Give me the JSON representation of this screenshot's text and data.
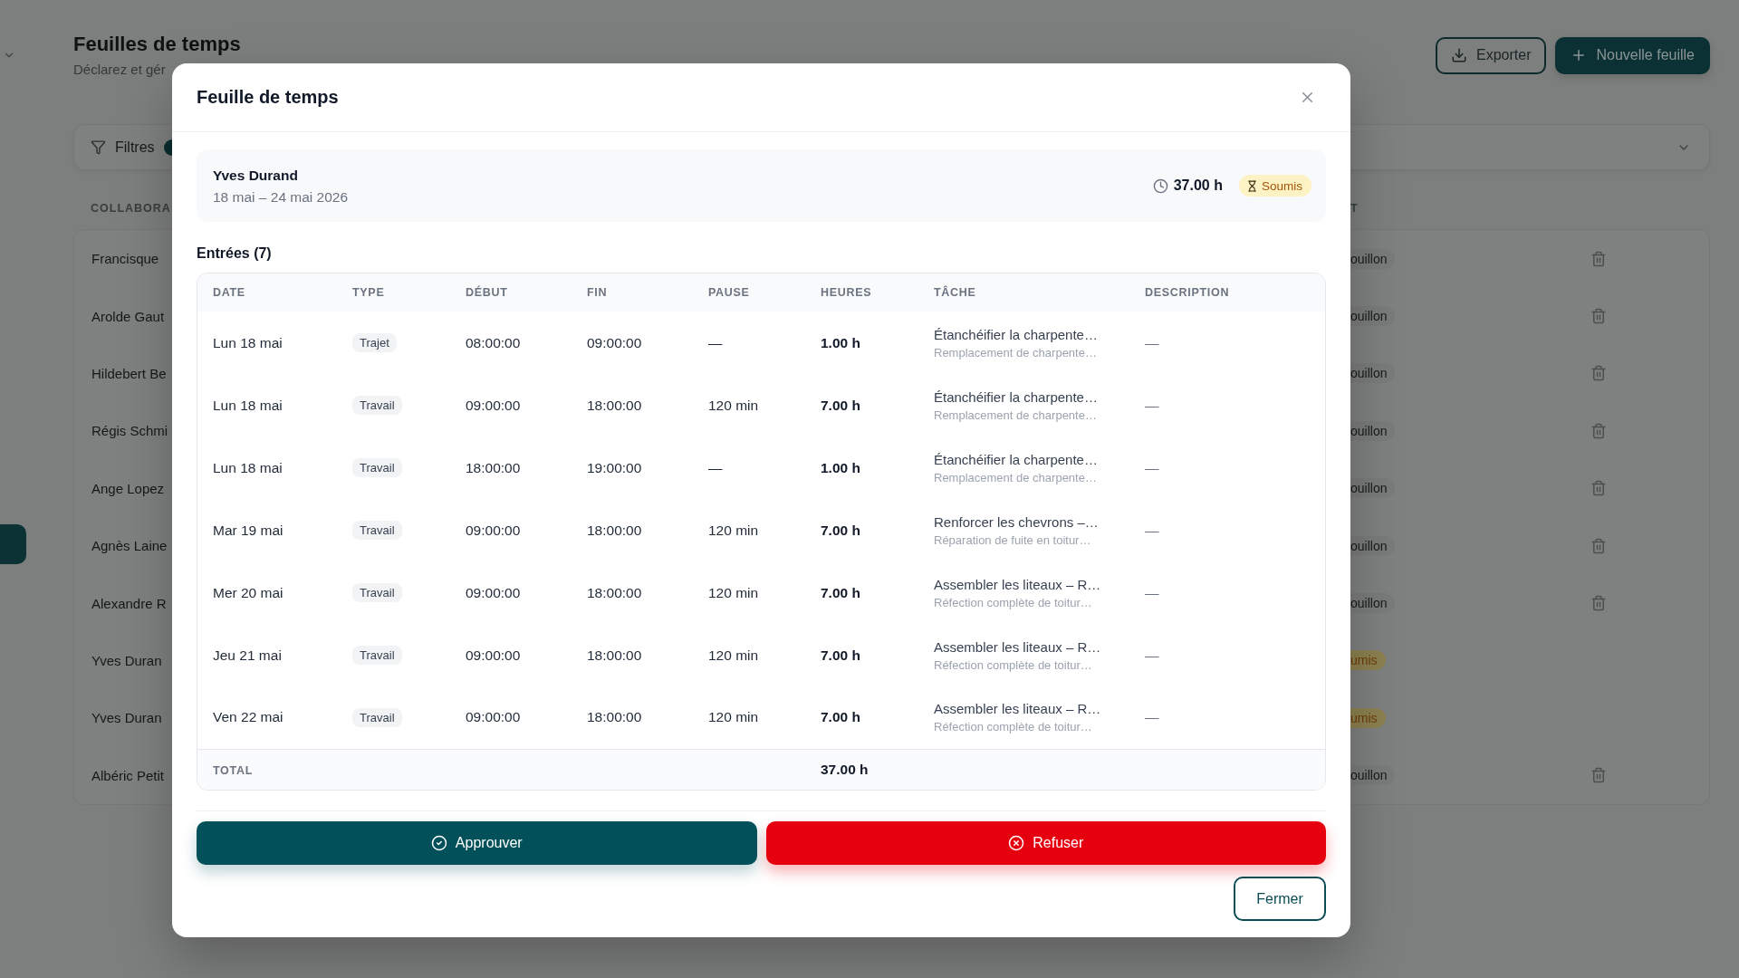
{
  "sidebar": {
    "items": [
      {
        "selected": true
      }
    ]
  },
  "page": {
    "title": "Feuilles de temps",
    "subtitle": "Déclarez et gér",
    "actions": [
      {
        "kind": "outline",
        "label": "Exporter"
      },
      {
        "kind": "primary",
        "label": "Nouvelle feuille"
      }
    ]
  },
  "filters": {
    "label": "Filtres"
  },
  "list": {
    "columns": [
      "COLLABORA",
      "T"
    ],
    "rows": [
      {
        "name": "Francisque",
        "status": {
          "label": "ouillon",
          "kind": "draft"
        }
      },
      {
        "name": "Arolde Gaut",
        "status": {
          "label": "ouillon",
          "kind": "draft"
        }
      },
      {
        "name": "Hildebert Be",
        "status": {
          "label": "ouillon",
          "kind": "draft"
        }
      },
      {
        "name": "Régis Schmi",
        "status": {
          "label": "ouillon",
          "kind": "draft"
        }
      },
      {
        "name": "Ange Lopez",
        "status": {
          "label": "ouillon",
          "kind": "draft"
        }
      },
      {
        "name": "Agnès Laine",
        "status": {
          "label": "ouillon",
          "kind": "draft"
        }
      },
      {
        "name": "Alexandre R",
        "status": {
          "label": "ouillon",
          "kind": "draft"
        }
      },
      {
        "name": "Yves Duran",
        "status": {
          "label": "umis",
          "kind": "submitted"
        }
      },
      {
        "name": "Yves Duran",
        "status": {
          "label": "umis",
          "kind": "submitted"
        }
      },
      {
        "name": "Albéric Petit",
        "status": {
          "label": "ouillon",
          "kind": "draft"
        }
      }
    ]
  },
  "modal": {
    "title": "Feuille de temps",
    "employee": "Yves Durand",
    "period": "18 mai – 24 mai 2026",
    "total_hours": "37.00 h",
    "status": {
      "label": "Soumis",
      "kind": "submitted"
    },
    "entries_title": "Entrées (7)",
    "table": {
      "columns": [
        "DATE",
        "TYPE",
        "DÉBUT",
        "FIN",
        "PAUSE",
        "HEURES",
        "TÂCHE",
        "DESCRIPTION"
      ],
      "rows": [
        {
          "date": "Lun 18 mai",
          "type": "Trajet",
          "start": "08:00:00",
          "end": "09:00:00",
          "pause": "—",
          "hours": "1.00 h",
          "task": "Étanchéifier la charpente…",
          "project": "Remplacement de charpente…",
          "description": "—"
        },
        {
          "date": "Lun 18 mai",
          "type": "Travail",
          "start": "09:00:00",
          "end": "18:00:00",
          "pause": "120 min",
          "hours": "7.00 h",
          "task": "Étanchéifier la charpente…",
          "project": "Remplacement de charpente…",
          "description": "—"
        },
        {
          "date": "Lun 18 mai",
          "type": "Travail",
          "start": "18:00:00",
          "end": "19:00:00",
          "pause": "—",
          "hours": "1.00 h",
          "task": "Étanchéifier la charpente…",
          "project": "Remplacement de charpente…",
          "description": "—"
        },
        {
          "date": "Mar 19 mai",
          "type": "Travail",
          "start": "09:00:00",
          "end": "18:00:00",
          "pause": "120 min",
          "hours": "7.00 h",
          "task": "Renforcer les chevrons –…",
          "project": "Réparation de fuite en toitur…",
          "description": "—"
        },
        {
          "date": "Mer 20 mai",
          "type": "Travail",
          "start": "09:00:00",
          "end": "18:00:00",
          "pause": "120 min",
          "hours": "7.00 h",
          "task": "Assembler les liteaux – R…",
          "project": "Réfection complète de toitur…",
          "description": "—"
        },
        {
          "date": "Jeu 21 mai",
          "type": "Travail",
          "start": "09:00:00",
          "end": "18:00:00",
          "pause": "120 min",
          "hours": "7.00 h",
          "task": "Assembler les liteaux – R…",
          "project": "Réfection complète de toitur…",
          "description": "—"
        },
        {
          "date": "Ven 22 mai",
          "type": "Travail",
          "start": "09:00:00",
          "end": "18:00:00",
          "pause": "120 min",
          "hours": "7.00 h",
          "task": "Assembler les liteaux – R…",
          "project": "Réfection complète de toitur…",
          "description": "—"
        }
      ],
      "total": {
        "label": "TOTAL",
        "hours": "37.00 h"
      }
    },
    "actions": [
      {
        "kind": "approve",
        "label": "Approuver"
      },
      {
        "kind": "reject",
        "label": "Refuser"
      }
    ],
    "close_label": "Fermer"
  }
}
